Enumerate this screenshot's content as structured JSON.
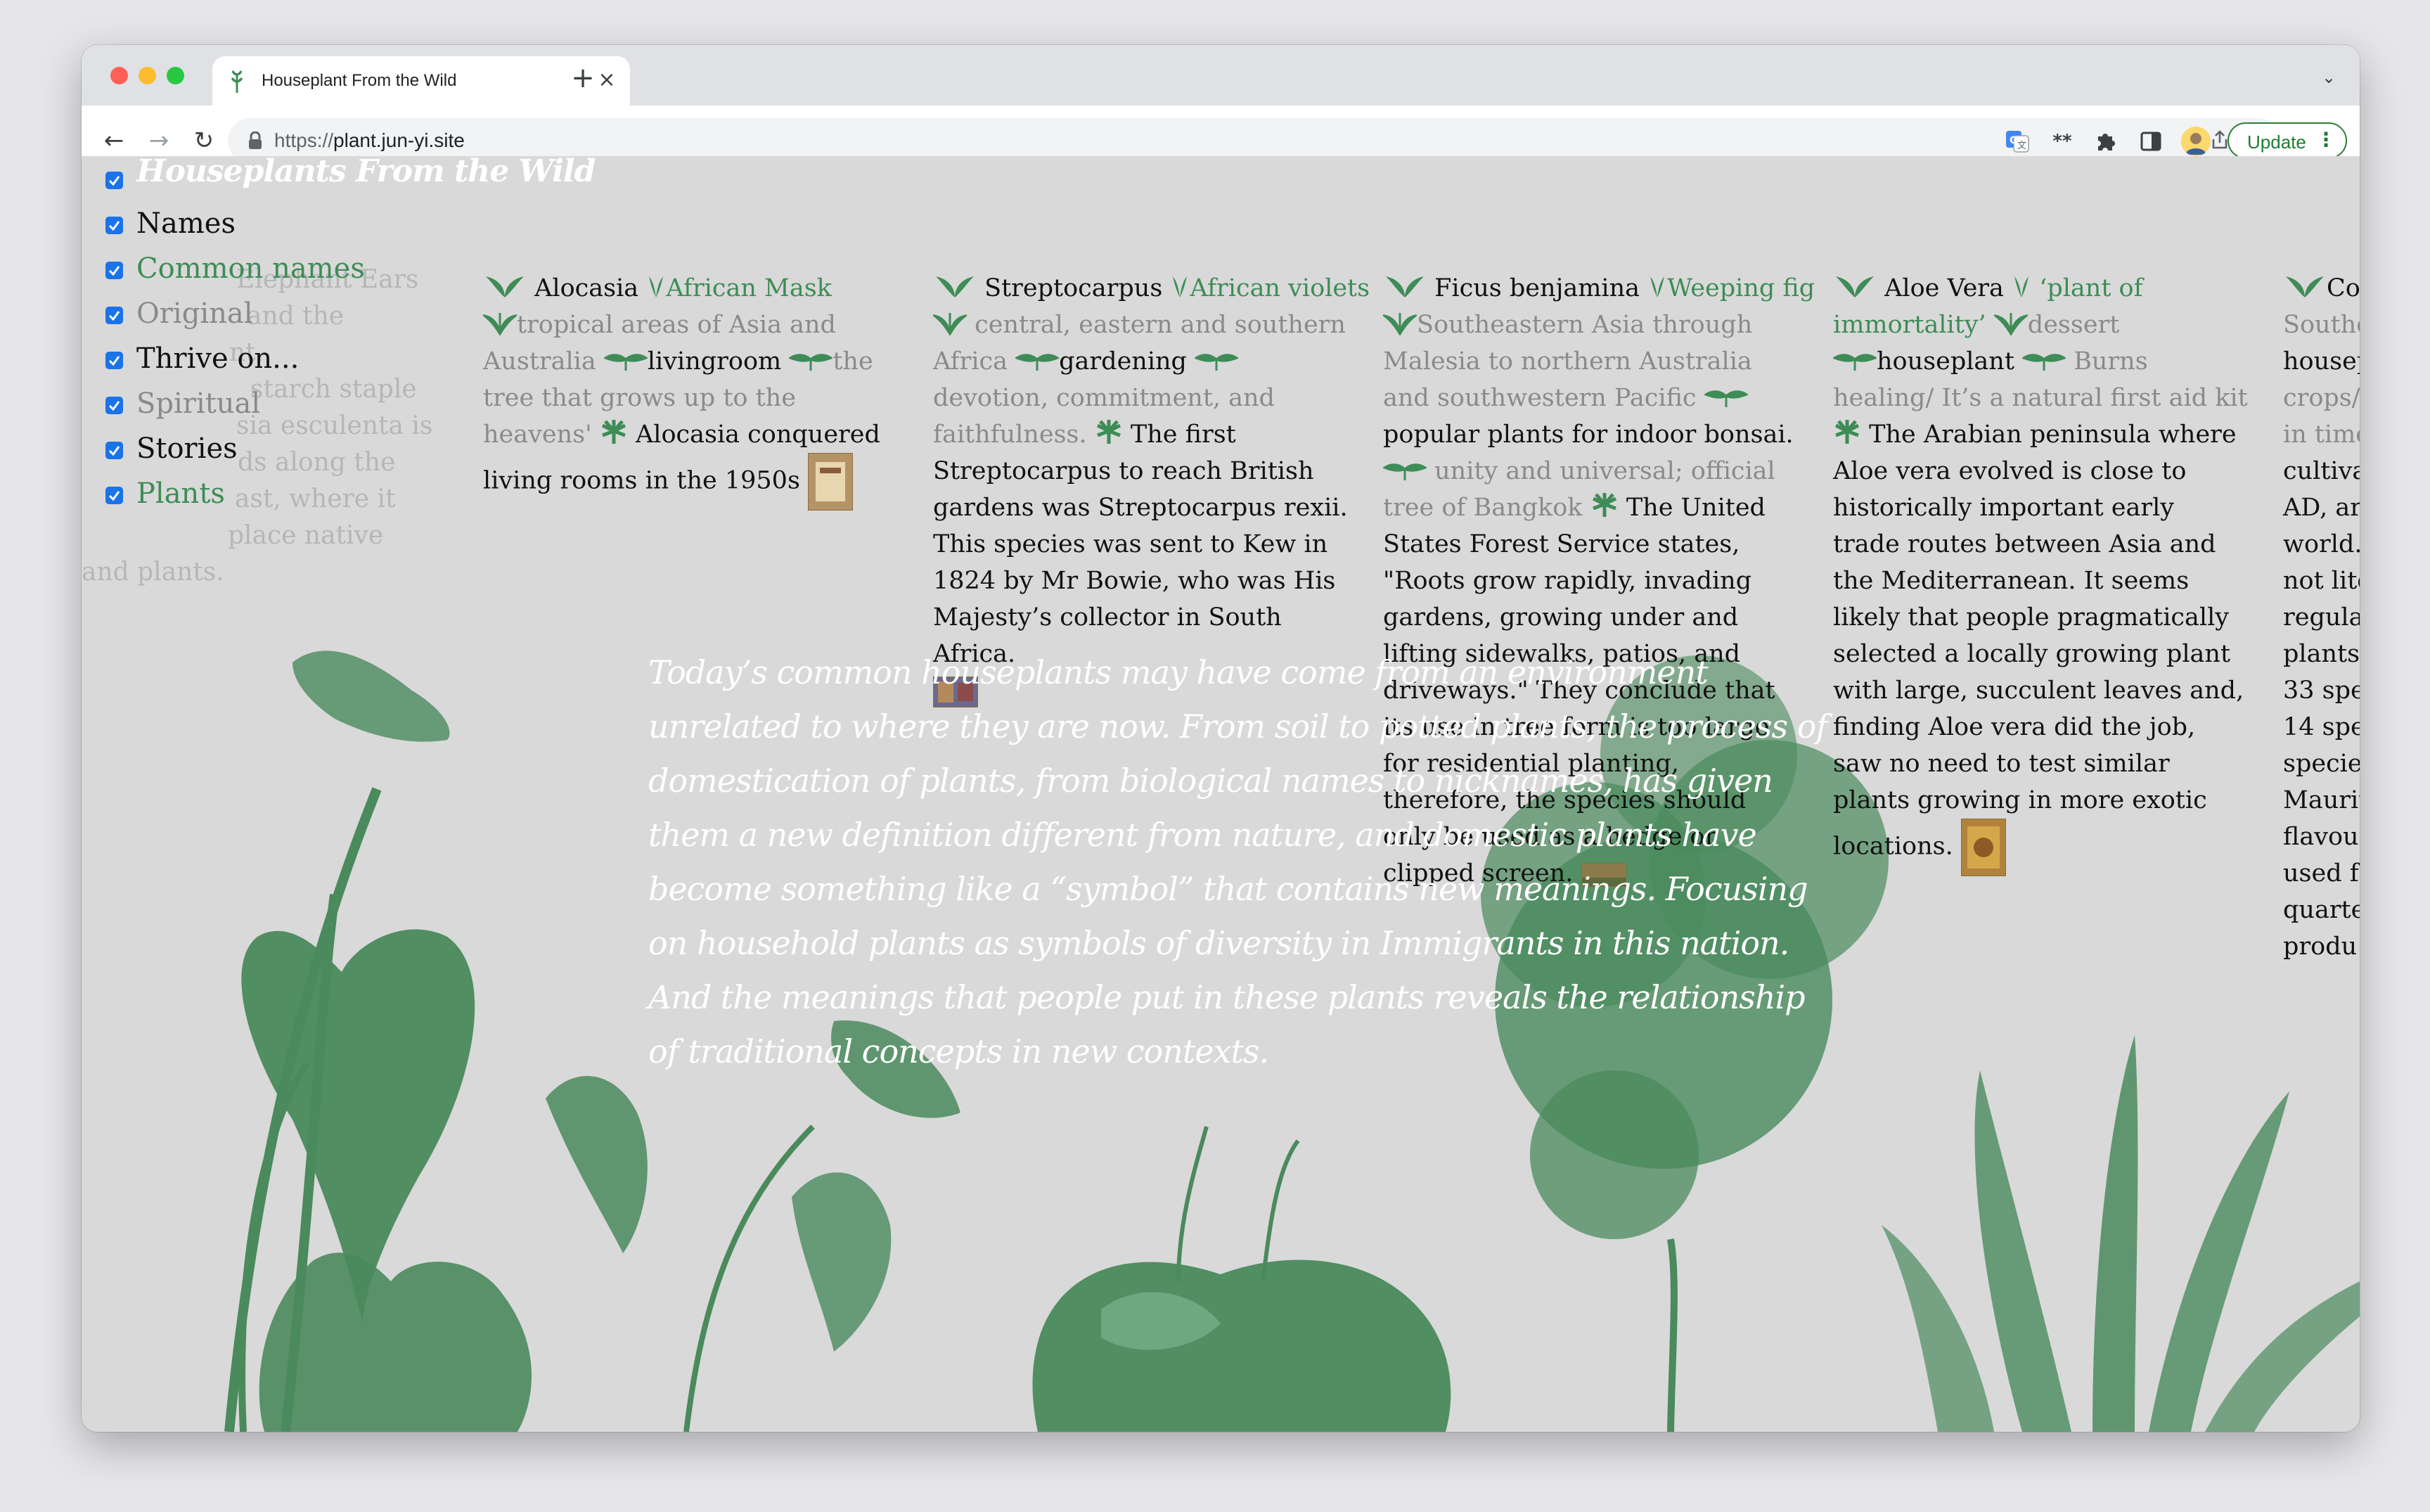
{
  "browser": {
    "tab_title": "Houseplant From the Wild",
    "new_tab_label": "+",
    "url_prefix": "https://",
    "url_host": "plant.jun-yi.site",
    "update_label": "Update"
  },
  "menu": {
    "title": "Houseplants From the Wild",
    "items": [
      {
        "label": "Names",
        "checked": true
      },
      {
        "label": "Common names",
        "checked": true
      },
      {
        "label": "Original",
        "checked": true
      },
      {
        "label": "Thrive on...",
        "checked": true
      },
      {
        "label": "Spiritual",
        "checked": true
      },
      {
        "label": "Stories",
        "checked": true
      },
      {
        "label": "Plants",
        "checked": true
      }
    ]
  },
  "ghost_column": {
    "lines": [
      "Elephant Ears",
      "and the",
      "nt.",
      "starch staple",
      "sia esculenta is",
      "ds along the",
      "ast, where it",
      "place native",
      "and plants."
    ]
  },
  "plants": [
    {
      "name": "Alocasia",
      "common": "African Mask",
      "origin": "tropical areas of Asia and Australia",
      "thrive": "livingroom",
      "spiritual": "the tree that grows up to the heavens'",
      "story": "Alocasia conquered living rooms in the 1950s"
    },
    {
      "name": "Streptocarpus",
      "common": "African violets",
      "origin": "central, eastern and southern Africa",
      "thrive": "gardening",
      "spiritual": "devotion, commitment, and faithfulness.",
      "story": "The first Streptocarpus to reach British gardens was Streptocarpus rexii. This species was sent to Kew in 1824 by Mr Bowie, who was His Majesty’s collector in South Africa."
    },
    {
      "name": "Ficus benjamina",
      "common": "Weeping fig",
      "origin": "Southeastern Asia through Malesia to northern Australia and southwestern Pacific",
      "thrive": "popular plants for indoor bonsai.",
      "spiritual": "unity and universal; official tree of Bangkok",
      "story": "The United States Forest Service states, \"Roots grow rapidly, invading gardens, growing under and lifting sidewalks, patios, and driveways.\" They conclude that its use in tree form is too large for residential planting, therefore, the species should only be used as a hedge or clipped screen."
    },
    {
      "name": "Aloe Vera",
      "common": "‘plant of immortality’",
      "origin": "dessert",
      "thrive": "houseplant",
      "spiritual": "Burns healing/ It’s a natural first aid kit",
      "story": "The Arabian peninsula where Aloe vera evolved is close to historically important early trade routes between Asia and the Mediterranean. It seems likely that people pragmatically selected a locally growing plant with large, succulent leaves and, finding Aloe vera did the job, saw no need to test similar plants growing in more exotic locations."
    }
  ],
  "partial_column": {
    "lines": [
      "Co",
      "Southe",
      "housep",
      "crops/",
      "in time",
      "cultiva",
      "AD, ar",
      "world.",
      "not lite",
      "regula",
      "plants",
      "33 spe",
      "14 spe",
      "species",
      "Mauriti",
      "flavour",
      "used fo",
      "quarte",
      "produ"
    ]
  },
  "quote": "Today’s common houseplants may have come from an environment unrelated to where they are now. From soil to potted plants, the process of domestication of plants, from biological names to nicknames, has given them a new definition different from nature, and domestic plants have become something like a “symbol” that contains new meanings. Focusing on household plants as symbols of diversity in Immigrants in this nation. And the meanings that people put in these plants reveals the relationship of traditional concepts in new contexts.",
  "colors": {
    "accent_green": "#3e8c56",
    "plant_green": "#4a8a5c",
    "page_bg": "#d9d9d9",
    "update_green": "#1e7d34"
  }
}
